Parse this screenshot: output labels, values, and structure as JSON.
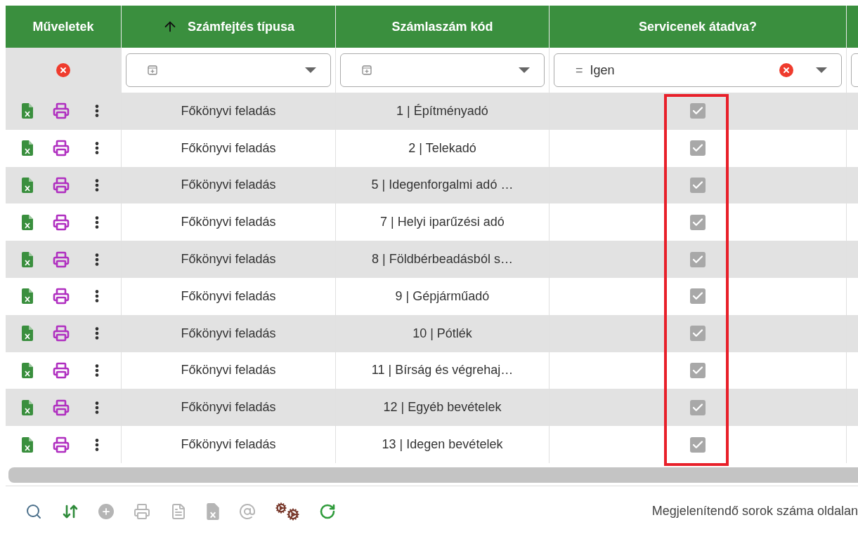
{
  "table": {
    "columns": [
      {
        "label": "Műveletek",
        "sorted_ascending": false
      },
      {
        "label": "Számfejtés típusa",
        "sorted_ascending": true
      },
      {
        "label": "Számlaszám kód",
        "sorted_ascending": false
      },
      {
        "label": "Servicenek átadva?",
        "sorted_ascending": false
      }
    ],
    "filters": [
      {
        "kind": "clear"
      },
      {
        "kind": "select"
      },
      {
        "kind": "select"
      },
      {
        "kind": "select",
        "operator": "=",
        "value": "Igen"
      }
    ],
    "rows": [
      {
        "type": "Főkönyvi feladás",
        "code": "1 | Építményadó",
        "transferred": true
      },
      {
        "type": "Főkönyvi feladás",
        "code": "2 | Telekadó",
        "transferred": true
      },
      {
        "type": "Főkönyvi feladás",
        "code": "5 | Idegenforgalmi adó …",
        "transferred": true
      },
      {
        "type": "Főkönyvi feladás",
        "code": "7 | Helyi iparűzési adó",
        "transferred": true
      },
      {
        "type": "Főkönyvi feladás",
        "code": "8 | Földbérbeadásból s…",
        "transferred": true
      },
      {
        "type": "Főkönyvi feladás",
        "code": "9 | Gépjárműadó",
        "transferred": true
      },
      {
        "type": "Főkönyvi feladás",
        "code": "10 | Pótlék",
        "transferred": true
      },
      {
        "type": "Főkönyvi feladás",
        "code": "11 | Bírság és végrehaj…",
        "transferred": true
      },
      {
        "type": "Főkönyvi feladás",
        "code": "12 | Egyéb bevételek",
        "transferred": true
      },
      {
        "type": "Főkönyvi feladás",
        "code": "13 | Idegen bevételek",
        "transferred": true
      }
    ]
  },
  "toolbar": [
    {
      "kind": "search",
      "disabled": false
    },
    {
      "kind": "swap",
      "disabled": false
    },
    {
      "kind": "add",
      "disabled": true
    },
    {
      "kind": "print",
      "disabled": true
    },
    {
      "kind": "document",
      "disabled": true
    },
    {
      "kind": "excel",
      "disabled": true
    },
    {
      "kind": "email",
      "disabled": true
    },
    {
      "kind": "settings",
      "disabled": false
    },
    {
      "kind": "refresh",
      "disabled": false
    }
  ],
  "footer": {
    "page_size_label": "Megjelenítendő sorok száma oldalan"
  }
}
